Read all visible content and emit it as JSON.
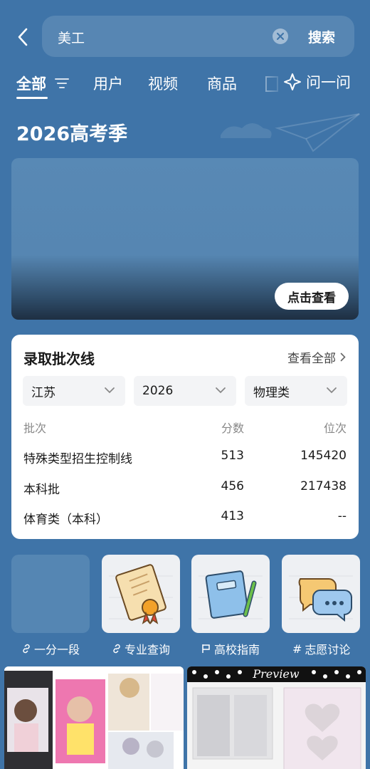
{
  "search": {
    "query": "美工",
    "submit_label": "搜索"
  },
  "tabs": [
    {
      "label": "全部",
      "active": true
    },
    {
      "label": "用户"
    },
    {
      "label": "视频"
    },
    {
      "label": "商品"
    }
  ],
  "ask_label": "问一问",
  "section_title": "2026高考季",
  "banner": {
    "button_label": "点击查看"
  },
  "score_card": {
    "title": "录取批次线",
    "view_all_label": "查看全部",
    "filters": {
      "province": "江苏",
      "year": "2026",
      "subject": "物理类"
    },
    "columns": [
      "批次",
      "分数",
      "位次"
    ],
    "rows": [
      {
        "batch": "特殊类型招生控制线",
        "score": "513",
        "rank": "145420"
      },
      {
        "batch": "本科批",
        "score": "456",
        "rank": "217438"
      },
      {
        "batch": "体育类（本科）",
        "score": "413",
        "rank": "--"
      }
    ]
  },
  "quick_links": [
    {
      "label": "一分一段",
      "icon": "link-icon"
    },
    {
      "label": "专业查询",
      "icon": "link-icon"
    },
    {
      "label": "高校指南",
      "icon": "flag-icon"
    },
    {
      "label": "志愿讨论",
      "icon": "hash-icon"
    }
  ],
  "feed": {
    "right_header": "Preview"
  },
  "colors": {
    "background": "#3f74a8",
    "card": "#ffffff",
    "accent_text": "#1a1a1a"
  }
}
